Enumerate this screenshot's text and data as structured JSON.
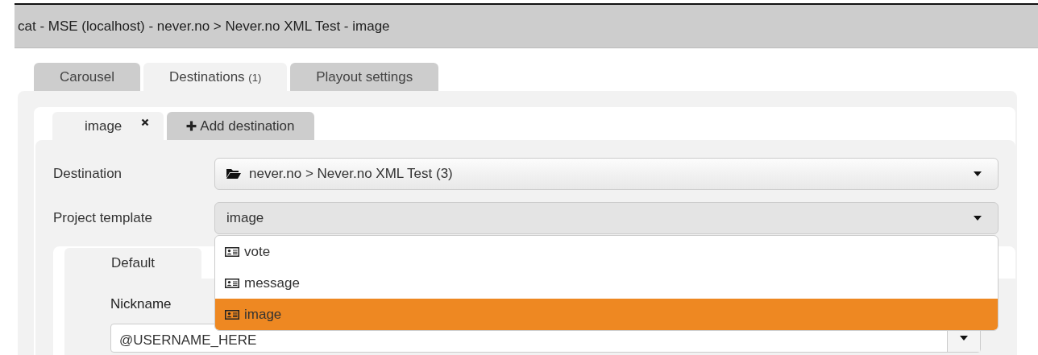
{
  "window": {
    "title": "cat - MSE (localhost) - never.no > Never.no XML Test - image"
  },
  "tabs": [
    {
      "label": "Carousel",
      "selected": false
    },
    {
      "label": "Destinations",
      "count": "(1)",
      "selected": true
    },
    {
      "label": "Playout settings",
      "selected": false
    }
  ],
  "destination_tabs": [
    {
      "kind": "destination",
      "label": "image",
      "selected": true,
      "closable": true
    },
    {
      "kind": "add",
      "label": "Add destination",
      "selected": false
    }
  ],
  "fields": [
    {
      "label": "Destination",
      "value": "never.no > Never.no XML Test (3)",
      "kind": "folder",
      "open": false
    },
    {
      "label": "Project template",
      "value": "image",
      "kind": "plain",
      "open": true
    }
  ],
  "dropdown": {
    "options": [
      {
        "label": "vote",
        "selected": false
      },
      {
        "label": "message",
        "selected": false
      },
      {
        "label": "image",
        "selected": true
      }
    ]
  },
  "subtabs": [
    {
      "label": "Default",
      "selected": true
    }
  ],
  "nickname": {
    "label": "Nickname",
    "value": "@USERNAME_HERE"
  }
}
